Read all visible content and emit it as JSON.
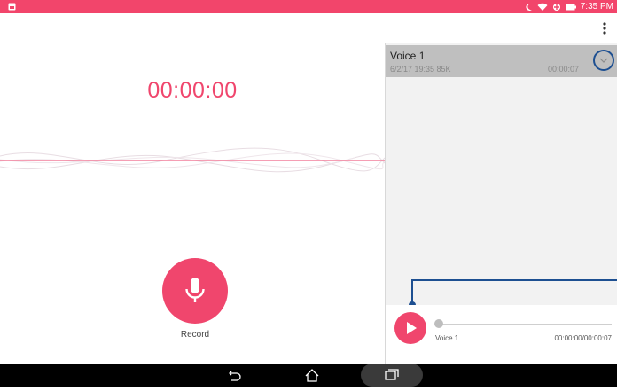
{
  "status_bar": {
    "time": "7:35 PM",
    "icons": [
      "notification-icon",
      "moon-icon",
      "wifi-icon",
      "data-saver-icon",
      "battery-icon"
    ],
    "color": "#f2456b"
  },
  "recorder": {
    "timer": "00:00:00",
    "record_label": "Record",
    "accent_color": "#f0466d"
  },
  "recordings": [
    {
      "title": "Voice 1",
      "meta": "6/2/17 19:35  85K",
      "duration": "00:00:07"
    }
  ],
  "player": {
    "name": "Voice 1",
    "time": "00:00:00/00:00:07",
    "progress": 0
  },
  "nav_bar": {
    "icons": [
      "back-icon",
      "home-icon",
      "recent-apps-icon"
    ]
  }
}
